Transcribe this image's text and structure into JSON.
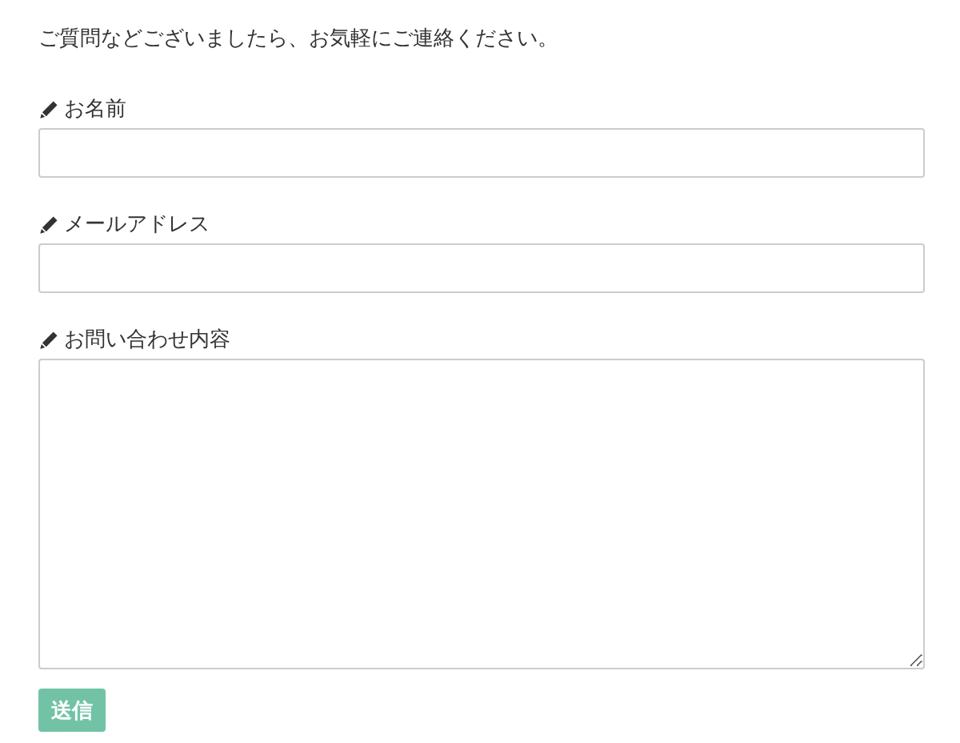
{
  "intro": "ご質問などございましたら、お気軽にご連絡ください。",
  "fields": [
    {
      "label": "お名前",
      "kind": "text"
    },
    {
      "label": "メールアドレス",
      "kind": "text"
    },
    {
      "label": "お問い合わせ内容",
      "kind": "textarea"
    }
  ],
  "submit": "送信"
}
